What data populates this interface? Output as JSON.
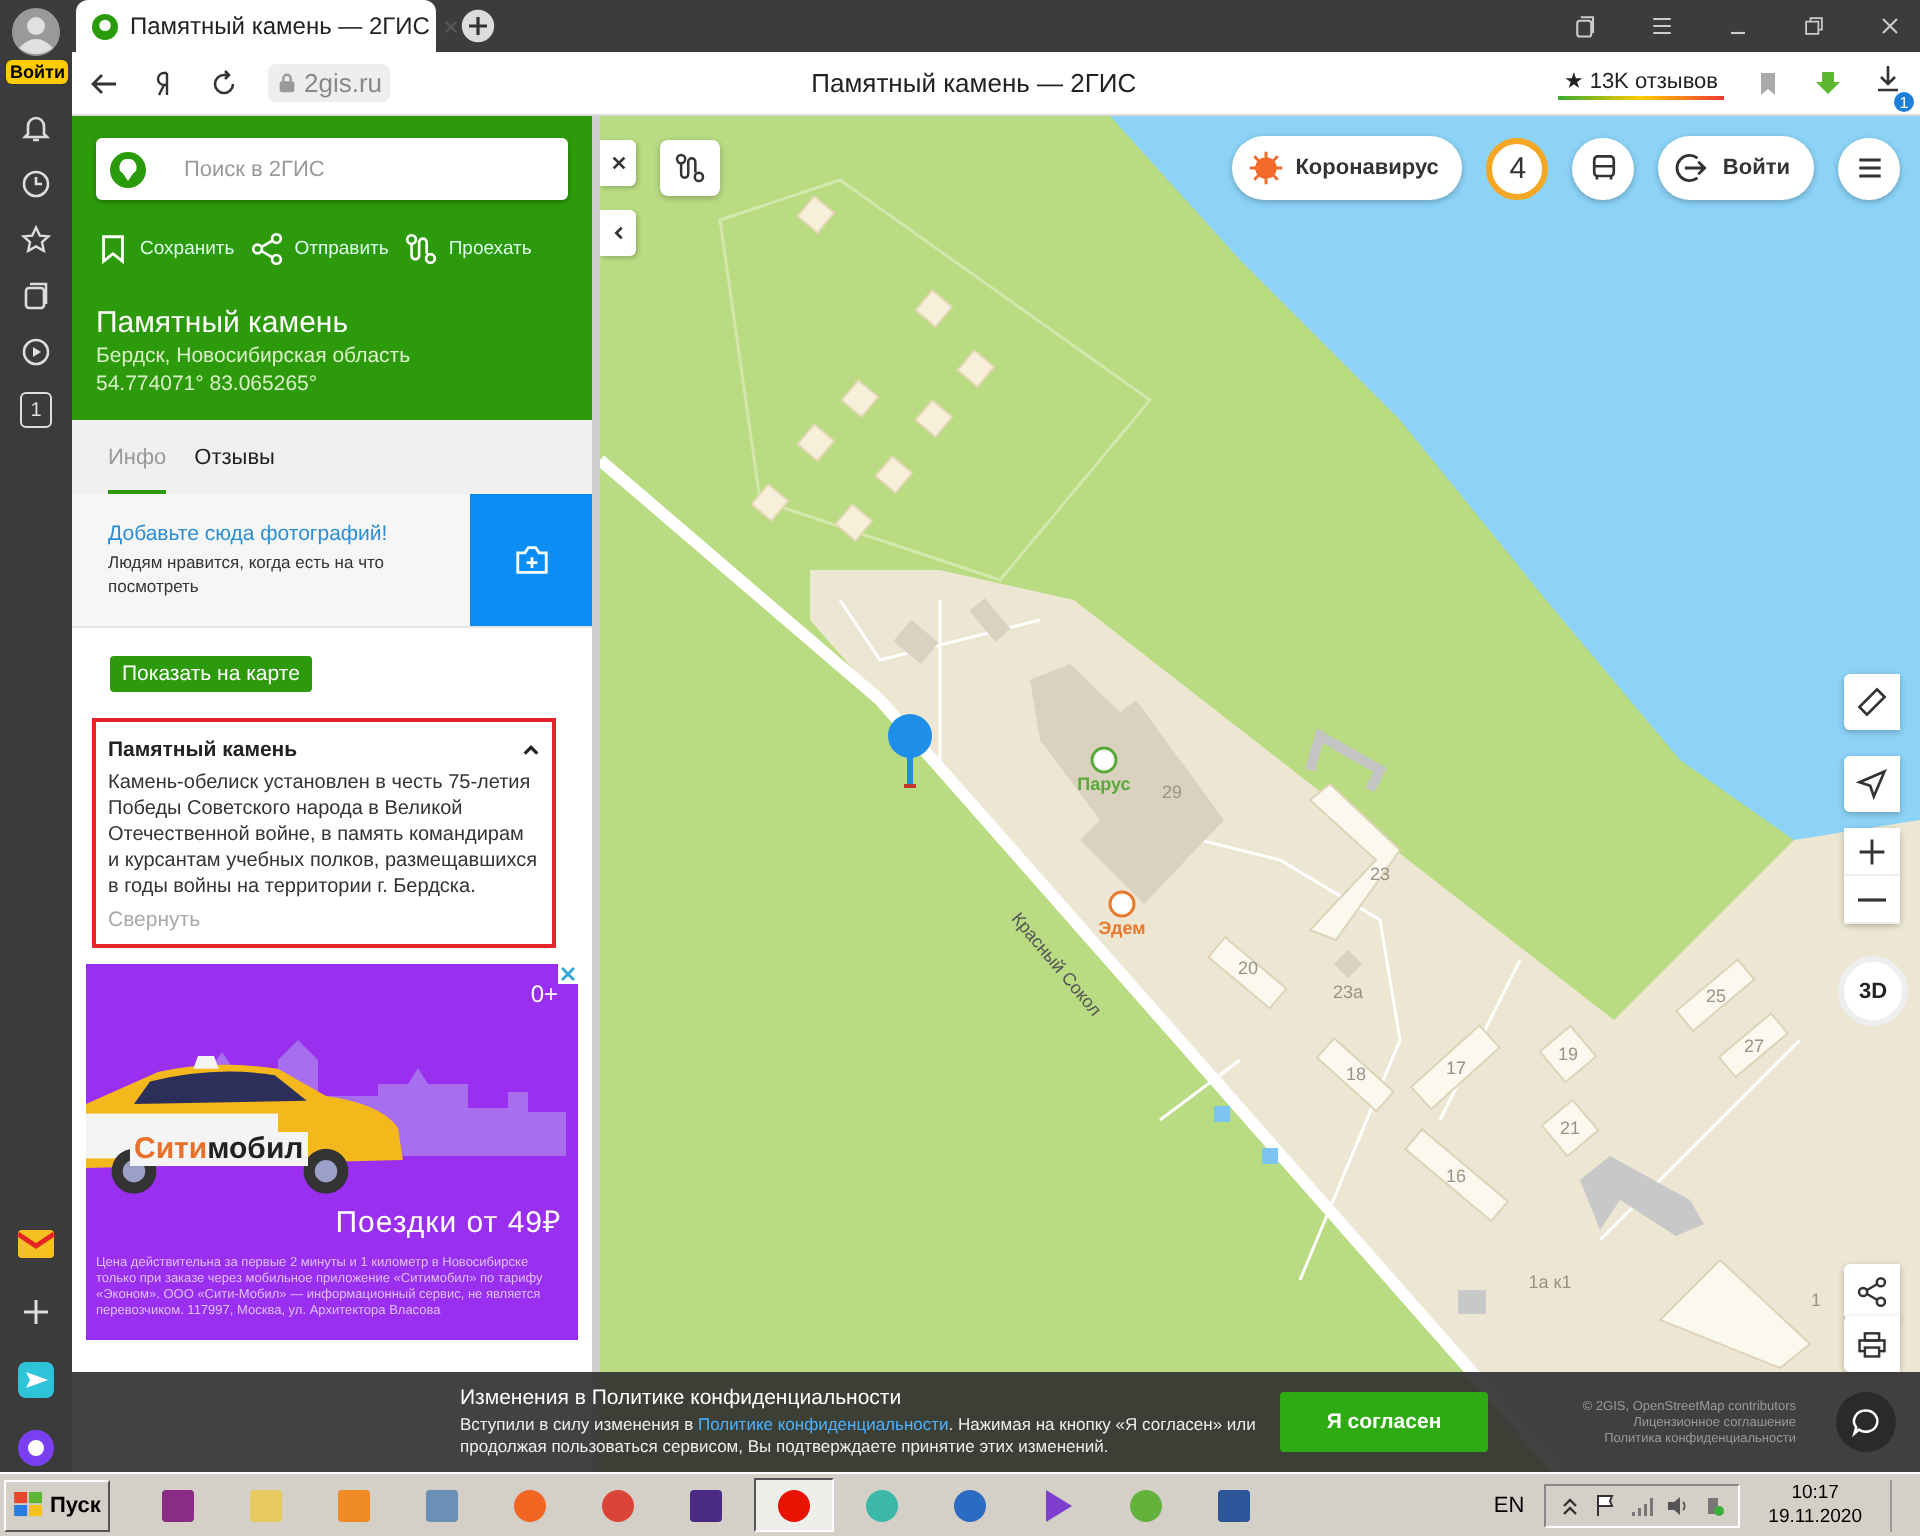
{
  "browser_sidebar": {
    "login": "Войти",
    "items": [
      {
        "kind": "bell"
      },
      {
        "kind": "clock"
      },
      {
        "kind": "star"
      },
      {
        "kind": "collections"
      },
      {
        "kind": "play"
      },
      {
        "kind": "counter",
        "label": "1"
      }
    ],
    "bottom_items": [
      {
        "kind": "mail"
      },
      {
        "kind": "add"
      },
      {
        "kind": "messenger"
      },
      {
        "kind": "alice"
      }
    ]
  },
  "tab": {
    "title": "Памятный камень — 2ГИС"
  },
  "address_bar": {
    "domain": "2gis.ru",
    "page_title": "Памятный камень — 2ГИС",
    "reviews": "★ 13K отзывов",
    "downloads_badge": "1"
  },
  "place_panel": {
    "search": {
      "placeholder": "Поиск в 2ГИС"
    },
    "actions": [
      {
        "kind": "save",
        "label": "Сохранить"
      },
      {
        "kind": "share",
        "label": "Отправить"
      },
      {
        "kind": "route",
        "label": "Проехать"
      }
    ],
    "title": "Памятный камень",
    "address": "Бердск, Новосибирская область",
    "coordinates": "54.774071° 83.065265°",
    "tabs": [
      {
        "label": "Инфо",
        "selected": true
      },
      {
        "label": "Отзывы",
        "selected": false
      }
    ],
    "photo_prompt": {
      "link": "Добавьте сюда фотографий!",
      "text": "Людям нравится, когда есть на что посмотреть"
    },
    "show_on_map": "Показать на карте",
    "description": {
      "title": "Памятный камень",
      "expanded": true,
      "text": "Камень-обелиск установлен в честь 75-летия Победы Советского народа в Великой Отечественной войне, в память командирам и курсантам учебных полков, размещавшихся в годы войны на территории г. Бердска.",
      "collapse": "Свернуть"
    }
  },
  "ad": {
    "age_rating": "0+",
    "brand": "**Сити**мобил",
    "headline": "Поездки от 49₽",
    "fine_print": "Цена действительна за первые 2 минуты и 1 километр в Новосибирске только при заказе через мобильное приложение «Ситимобил» по тарифу «Эконом». ООО «Сити-Мобил» — информационный сервис, не является перевозчиком. 117997, Москва, ул. Архитектора Власова"
  },
  "map": {
    "top_buttons": [
      {
        "kind": "corona",
        "label": "Коронавирус"
      },
      {
        "kind": "count",
        "label": "4"
      },
      {
        "kind": "bus"
      },
      {
        "kind": "login",
        "label": "Войти"
      },
      {
        "kind": "menu"
      }
    ],
    "side_controls": [
      {
        "kind": "ruler"
      },
      {
        "kind": "locate"
      },
      {
        "kind": "zoom"
      },
      {
        "kind": "compass",
        "label": "3D"
      },
      {
        "kind": "share"
      },
      {
        "kind": "print"
      }
    ],
    "labels": [
      {
        "text": "Парус",
        "kind": "poi",
        "color": "#5ba83a"
      },
      {
        "text": "29",
        "kind": "house"
      },
      {
        "text": "23",
        "kind": "house"
      },
      {
        "text": "Эдем",
        "kind": "poi",
        "color": "#e8792b"
      },
      {
        "text": "Красный Сокол",
        "kind": "street"
      },
      {
        "text": "20",
        "kind": "house"
      },
      {
        "text": "23а",
        "kind": "house"
      },
      {
        "text": "18",
        "kind": "house"
      },
      {
        "text": "17",
        "kind": "house"
      },
      {
        "text": "19",
        "kind": "house"
      },
      {
        "text": "21",
        "kind": "house"
      },
      {
        "text": "25",
        "kind": "house"
      },
      {
        "text": "27",
        "kind": "house"
      },
      {
        "text": "16",
        "kind": "house"
      },
      {
        "text": "1а к1",
        "kind": "house"
      },
      {
        "text": "1",
        "kind": "house"
      }
    ],
    "copyright": [
      "© 2GIS, OpenStreetMap contributors",
      "Лицензионное соглашение",
      "Политика конфиденциальности"
    ]
  },
  "cookie_banner": {
    "title": "Изменения в Политике конфиденциальности",
    "text_before": "Вступили в силу изменения в ",
    "link": "Политике конфиденциальности",
    "text_after": ". Нажимая на кнопку «Я согласен» или продолжая пользоваться сервисом, Вы подтверждаете принятие этих изменений.",
    "button": "Я согласен"
  },
  "taskbar": {
    "start": "Пуск",
    "apps": [
      {
        "kind": "archive",
        "selected": false
      },
      {
        "kind": "folder",
        "selected": false
      },
      {
        "kind": "player",
        "selected": false
      },
      {
        "kind": "calculator",
        "selected": false
      },
      {
        "kind": "antivirus",
        "selected": false
      },
      {
        "kind": "chrome",
        "selected": false
      },
      {
        "kind": "pen",
        "selected": false
      },
      {
        "kind": "yandex",
        "selected": true
      },
      {
        "kind": "radar",
        "selected": false
      },
      {
        "kind": "globe",
        "selected": false
      },
      {
        "kind": "studio",
        "selected": false
      },
      {
        "kind": "torrent",
        "selected": false
      },
      {
        "kind": "word",
        "selected": false
      }
    ],
    "language": "EN",
    "time": "10:17",
    "date": "19.11.2020"
  }
}
